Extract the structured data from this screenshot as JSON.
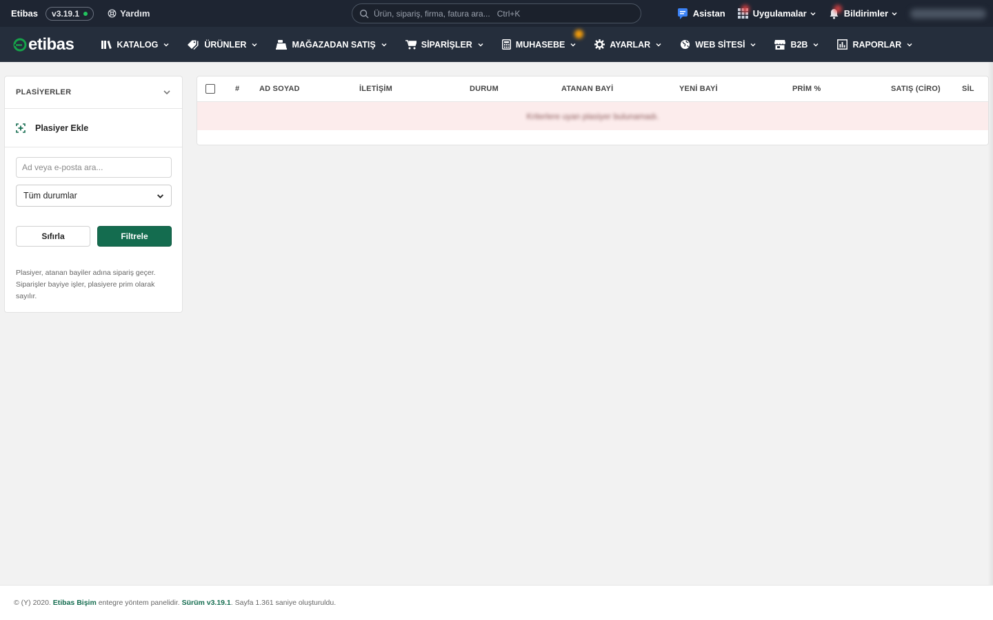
{
  "topbar": {
    "brand": "Etibas",
    "version": "v3.19.1",
    "help_label": "Yardım",
    "search_placeholder": "Ürün, sipariş, firma, fatura ara...",
    "search_shortcut": "Ctrl+K",
    "assistant_label": "Asistan",
    "apps_label": "Uygulamalar",
    "notifications_label": "Bildirimler"
  },
  "logo": {
    "text": "etibas"
  },
  "nav": {
    "items": [
      {
        "label": "KATALOG"
      },
      {
        "label": "ÜRÜNLER"
      },
      {
        "label": "MAĞAZADAN SATIŞ"
      },
      {
        "label": "SİPARİŞLER"
      },
      {
        "label": "MUHASEBE"
      },
      {
        "label": "AYARLAR"
      },
      {
        "label": "WEB SİTESİ"
      },
      {
        "label": "B2B"
      },
      {
        "label": "RAPORLAR"
      }
    ]
  },
  "sidebar": {
    "title": "PLASİYERLER",
    "add_label": "Plasiyer Ekle",
    "search_placeholder": "Ad veya e-posta ara...",
    "status_selected": "Tüm durumlar",
    "reset_label": "Sıfırla",
    "filter_label": "Filtrele",
    "note": "Plasiyer, atanan bayiler adına sipariş geçer. Siparişler bayiye işler, plasiyere prim olarak sayılır."
  },
  "table": {
    "columns": [
      "#",
      "AD SOYAD",
      "İLETİŞİM",
      "DURUM",
      "ATANAN BAYİ",
      "YENİ BAYİ",
      "PRİM %",
      "SATIŞ (CİRO)",
      "SİL"
    ],
    "empty_message": "Kriterlere uyan plasiyer bulunamadı."
  },
  "footer": {
    "prefix": "© (Y) 2020.",
    "company": "Etibas Bişim",
    "middle": "entegre yöntem panelidir.",
    "version_link": "Sürüm v3.19.1",
    "suffix": ". Sayfa 1.361 saniye oluşturuldu."
  },
  "colors": {
    "topbar_bg": "#1e2532",
    "nav_bg": "#252e3c",
    "primary_green": "#146c4f",
    "empty_row_bg": "#fcecec"
  }
}
